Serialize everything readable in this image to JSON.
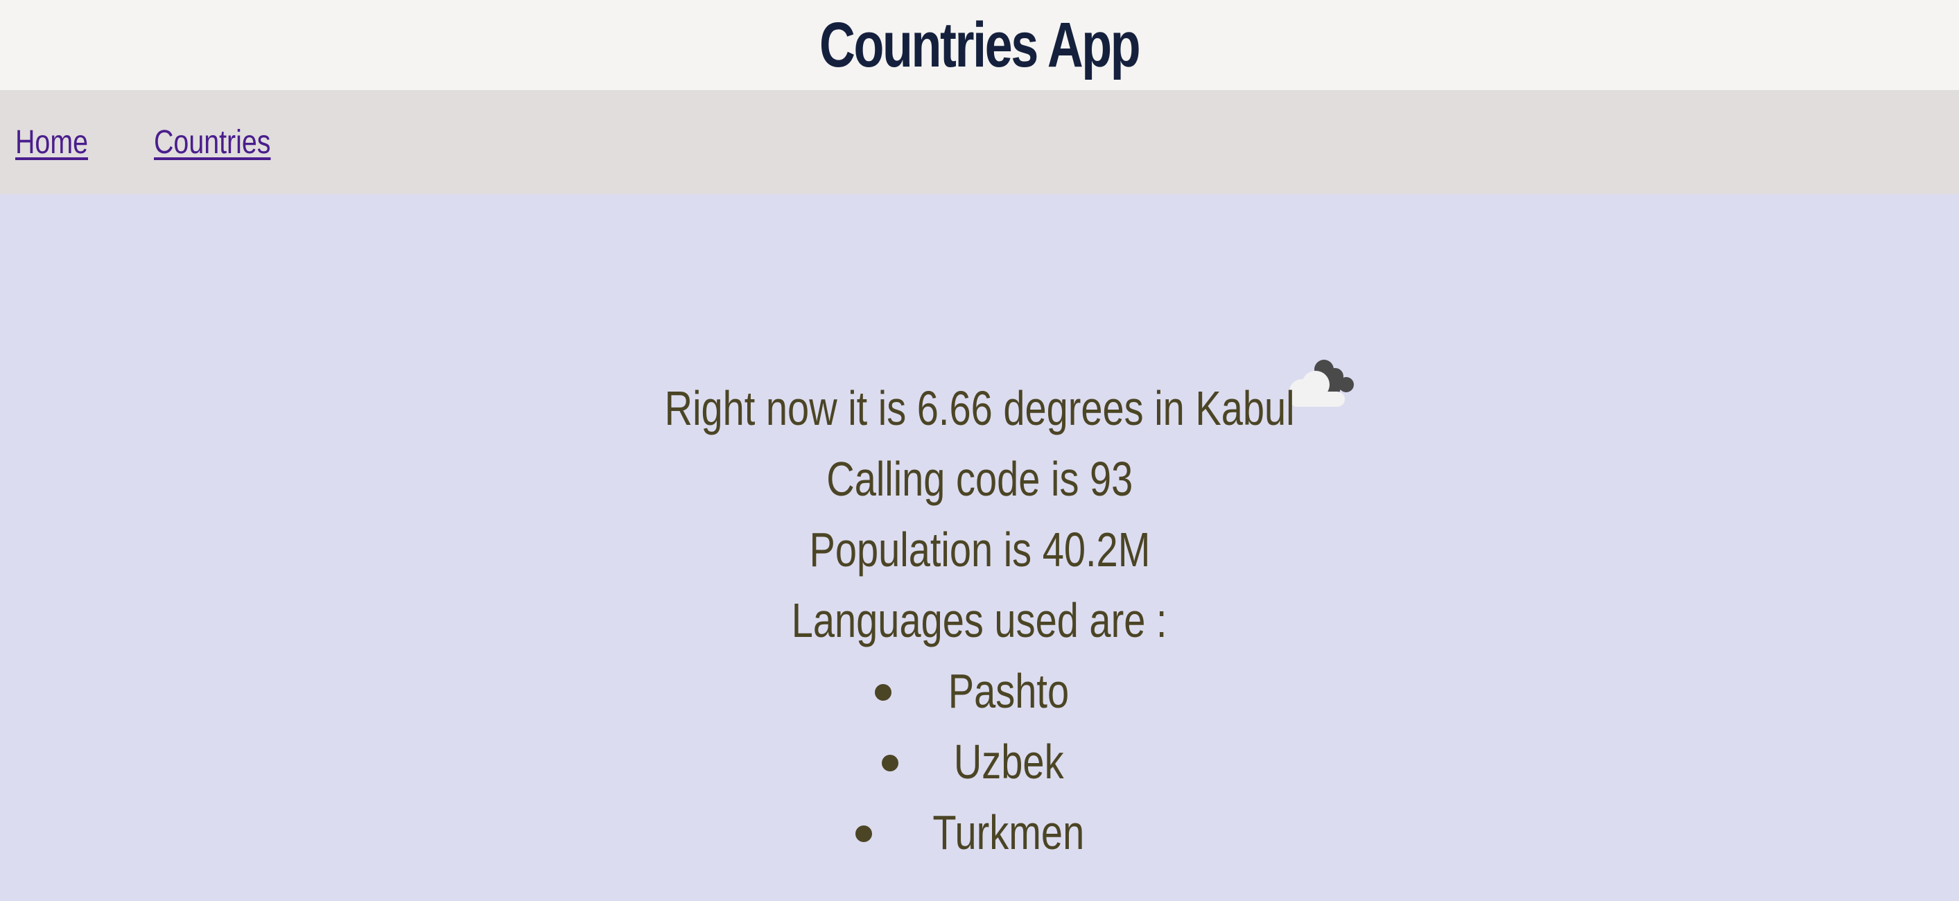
{
  "header": {
    "title": "Countries App"
  },
  "nav": {
    "items": [
      {
        "label": "Home"
      },
      {
        "label": "Countries"
      }
    ]
  },
  "country": {
    "weather_line": "Right now it is 6.66 degrees in Kabul",
    "weather_icon": "cloud-icon",
    "calling_code_line": "Calling code is 93",
    "population_line": "Population is 40.2M",
    "languages_heading": "Languages used are :",
    "languages": [
      "Pashto",
      "Uzbek",
      "Turkmen"
    ]
  },
  "colors": {
    "header_bg": "#f5f4f2",
    "nav_bg": "#e0dddc",
    "main_bg": "#dcdcf0",
    "title_color": "#15203d",
    "link_color": "#4a1d8c",
    "text_color": "#4b4525"
  }
}
